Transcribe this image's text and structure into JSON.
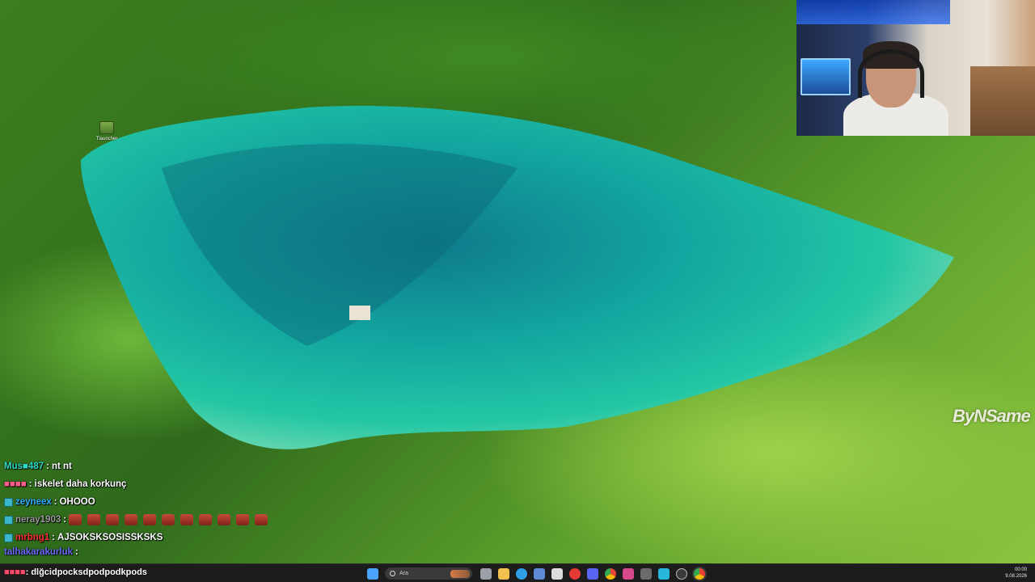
{
  "desktop": {
    "icons": [
      {
        "label": "Tlauncher",
        "icon": "minecraft-block-icon"
      }
    ]
  },
  "overlay": {
    "watermark": "ByNSame"
  },
  "chat": {
    "messages": [
      {
        "user": "Mus■487",
        "user_color": "#29d9c4",
        "badge": false,
        "text": "nt nt"
      },
      {
        "user": "■■■■",
        "user_color": "#ff5a8a",
        "badge": false,
        "text": "iskelet daha korkunç"
      },
      {
        "user": "zeyneex",
        "user_color": "#2fb0ff",
        "badge": true,
        "text": "OHOOO"
      },
      {
        "user": "neray1903",
        "user_color": "#9a9a9a",
        "badge": true,
        "text": "",
        "emotes": 11
      },
      {
        "user": "mrbng1",
        "user_color": "#ff3030",
        "badge": true,
        "text": "AJSOKSKSOSISSKSKS"
      },
      {
        "user": "talhakarakurluk",
        "user_color": "#6a6aff",
        "badge": false,
        "text": ""
      }
    ]
  },
  "taskbar": {
    "ticker_user": "■■■■",
    "ticker_text": "dlğcidpocksdpodpodkpods",
    "search_placeholder": "Ara",
    "apps": [
      {
        "name": "windows-start-icon",
        "color": "#4aa3ff"
      },
      {
        "name": "task-view-icon",
        "color": "#9aa0a6"
      },
      {
        "name": "file-explorer-icon",
        "color": "#f2c14e"
      },
      {
        "name": "edge-browser-icon",
        "color": "#2fa0e8"
      },
      {
        "name": "ms-store-icon",
        "color": "#5f8bd6"
      },
      {
        "name": "calendar-icon",
        "color": "#dcdcdc"
      },
      {
        "name": "red-app-icon",
        "color": "#e53935"
      },
      {
        "name": "discord-icon",
        "color": "#5865f2"
      },
      {
        "name": "chrome-icon",
        "color": "#34a853"
      },
      {
        "name": "gallery-icon",
        "color": "#d64a8c"
      },
      {
        "name": "terminal-icon",
        "color": "#6b6b6b"
      },
      {
        "name": "pixel-app-icon",
        "color": "#25b6d9"
      },
      {
        "name": "obs-icon",
        "color": "#3a3a3a"
      },
      {
        "name": "chrome-active-icon",
        "color": "#fbbc05"
      }
    ],
    "clock_time": "00:00",
    "clock_date": "9.08.2026"
  }
}
